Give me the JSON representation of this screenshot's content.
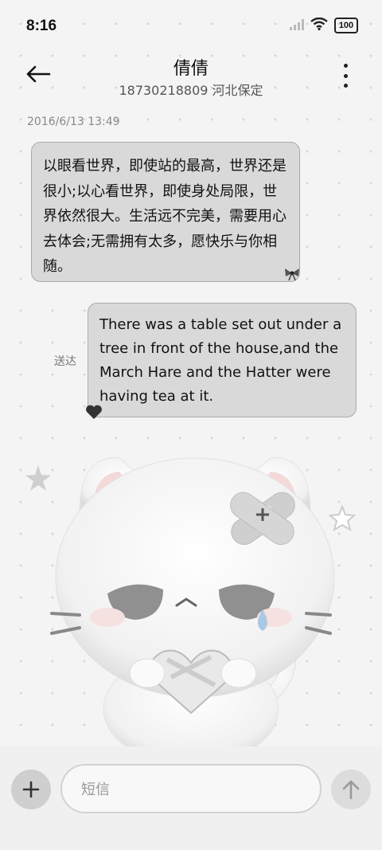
{
  "status_bar": {
    "time": "8:16",
    "battery": "100",
    "icons": [
      "signal-icon",
      "wifi-icon",
      "battery-icon"
    ]
  },
  "header": {
    "contact_name": "倩倩",
    "contact_sub": "18730218809 河北保定",
    "icons": [
      "back-arrow-icon",
      "more-vert-icon"
    ]
  },
  "conversation": {
    "timestamp": "2016/6/13 13:49",
    "received_message": "以眼看世界，即使站的最高，世界还是很小;以心看世界，即使身处局限，世界依然很大。生活远不完美，需要用心去体会;无需拥有太多，愿快乐与你相随。",
    "sent_status": "送达",
    "sent_message": "There was a table set out under a tree in front of the house,and the March Hare and the Hatter were having tea at it."
  },
  "composer": {
    "placeholder": "短信",
    "icons": [
      "plus-icon",
      "send-arrow-icon"
    ]
  },
  "colors": {
    "background": "#f4f4f4",
    "bubble": "#d9d9d9",
    "bubble_border": "#aaaaaa",
    "text": "#111111"
  }
}
